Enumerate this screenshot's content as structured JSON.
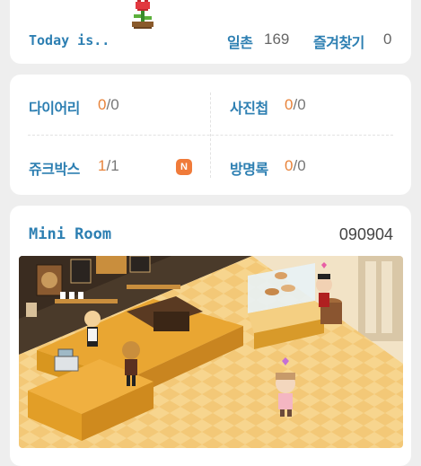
{
  "header": {
    "today_label": "Today is..",
    "today_icon": "tulip-flower-icon",
    "visitors_label": "일촌",
    "visitors_count": "169",
    "favorites_label": "즐겨찾기",
    "favorites_count": "0"
  },
  "menu": {
    "items": [
      {
        "label": "다이어리",
        "current": "0",
        "total": "/0",
        "badge": ""
      },
      {
        "label": "사진첩",
        "current": "0",
        "total": "/0",
        "badge": ""
      },
      {
        "label": "쥬크박스",
        "current": "1",
        "total": "/1",
        "badge": "N"
      },
      {
        "label": "방명록",
        "current": "0",
        "total": "/0",
        "badge": ""
      }
    ]
  },
  "miniroom": {
    "title": "Mini Room",
    "date": "090904",
    "scene": "pixel-cafe-room"
  },
  "colors": {
    "accent": "#2d7fb2",
    "count": "#e8833a",
    "badge": "#f07b3a",
    "background": "#eeeeee"
  }
}
